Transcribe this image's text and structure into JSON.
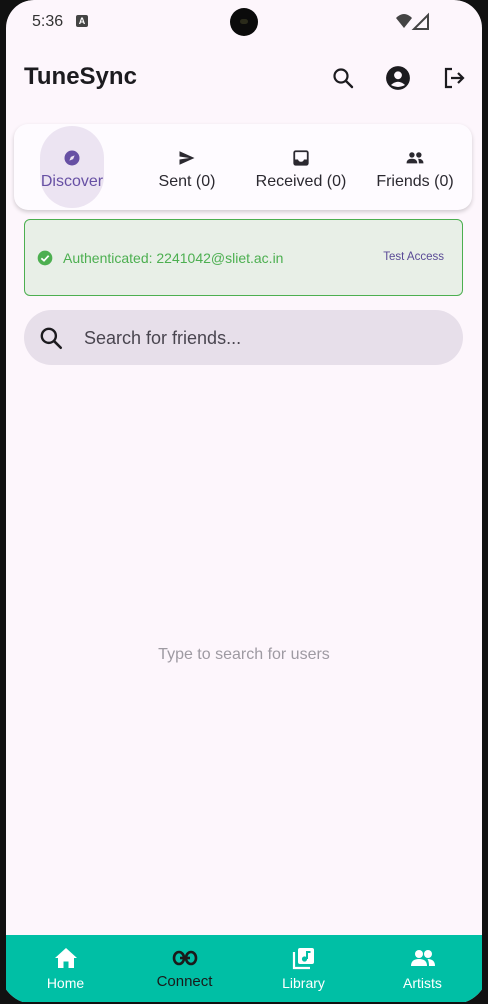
{
  "status_bar": {
    "time": "5:36",
    "notification_icon": "a-icon"
  },
  "app_bar": {
    "title": "TuneSync",
    "actions": [
      "search-icon",
      "account-circle-icon",
      "logout-icon"
    ]
  },
  "tabs": [
    {
      "label": "Discover",
      "icon": "compass-icon",
      "active": true
    },
    {
      "label": "Sent (0)",
      "icon": "send-icon",
      "active": false
    },
    {
      "label": "Received (0)",
      "icon": "inbox-icon",
      "active": false
    },
    {
      "label": "Friends (0)",
      "icon": "people-icon",
      "active": false
    }
  ],
  "auth_banner": {
    "text": "Authenticated: 2241042@sliet.ac.in",
    "action_label": "Test Access"
  },
  "search": {
    "placeholder": "Search for friends...",
    "value": ""
  },
  "empty_state": {
    "text": "Type to search for users"
  },
  "bottom_nav": [
    {
      "label": "Home",
      "icon": "home-icon",
      "active": false
    },
    {
      "label": "Connect",
      "icon": "link-icon",
      "active": true
    },
    {
      "label": "Library",
      "icon": "library-music-icon",
      "active": false
    },
    {
      "label": "Artists",
      "icon": "people-icon",
      "active": false
    }
  ],
  "colors": {
    "accent": "#6750a4",
    "success": "#4caf50",
    "nav_background": "#00bfa5",
    "background": "#fdf6fc"
  }
}
